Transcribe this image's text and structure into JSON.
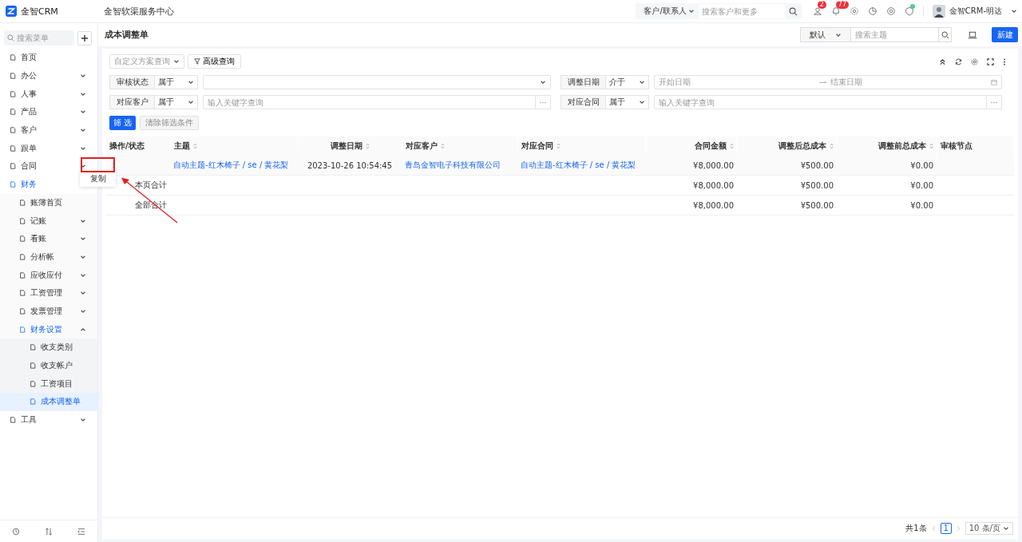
{
  "header": {
    "logo_text": "金智CRM",
    "title": "金智软渠服务中心",
    "search_scope": "客户/联系人",
    "search_placeholder": "搜索客户和更多",
    "contacts_badge": "2",
    "notice_badge": "77",
    "user_name": "金智CRM-明达"
  },
  "sidebar": {
    "search_placeholder": "搜索菜单",
    "items": [
      {
        "label": "首页",
        "selected": false
      },
      {
        "label": "办公",
        "selected": false,
        "expanded": false
      },
      {
        "label": "人事",
        "selected": false,
        "expanded": false
      },
      {
        "label": "产品",
        "selected": false,
        "expanded": false
      },
      {
        "label": "客户",
        "selected": false,
        "expanded": false
      },
      {
        "label": "跟单",
        "selected": false,
        "expanded": false
      },
      {
        "label": "合同",
        "selected": false,
        "expanded": false
      },
      {
        "label": "财务",
        "selected": false,
        "expanded": true,
        "children": [
          {
            "label": "账簿首页",
            "selected": false
          },
          {
            "label": "记账",
            "selected": false,
            "expanded": false
          },
          {
            "label": "看账",
            "selected": false,
            "expanded": false
          },
          {
            "label": "分析帐",
            "selected": false,
            "expanded": false
          },
          {
            "label": "应收应付",
            "selected": false,
            "expanded": false
          },
          {
            "label": "工资管理",
            "selected": false,
            "expanded": false
          },
          {
            "label": "发票管理",
            "selected": false,
            "expanded": false
          },
          {
            "label": "财务设置",
            "selected": false,
            "expanded": true,
            "children": [
              {
                "label": "收支类别",
                "selected": false
              },
              {
                "label": "收支帐户",
                "selected": false
              },
              {
                "label": "工资项目",
                "selected": false
              },
              {
                "label": "成本调整单",
                "selected": true
              }
            ]
          }
        ]
      },
      {
        "label": "工具",
        "selected": false,
        "expanded": false
      }
    ]
  },
  "page": {
    "title": "成本调整单",
    "view": "默认",
    "search_placeholder": "搜索主题",
    "new_button": "新建"
  },
  "filters": {
    "scheme_placeholder": "自定义方案查询",
    "advanced_button": "高级查询",
    "rows": [
      {
        "label": "审核状态",
        "operator": "属于",
        "kind": "select"
      },
      {
        "label": "调整日期",
        "operator": "介于",
        "kind": "date",
        "start_placeholder": "开始日期",
        "end_placeholder": "结束日期"
      },
      {
        "label": "对应客户",
        "operator": "属于",
        "kind": "lookup",
        "placeholder": "输入关键字查询"
      },
      {
        "label": "对应合同",
        "operator": "属于",
        "kind": "lookup",
        "placeholder": "输入关键字查询"
      }
    ],
    "filter_button": "筛 选",
    "clear_button": {
      "label": "清除筛选条件",
      "disabled": true
    }
  },
  "table": {
    "columns": [
      {
        "label": "操作/状态",
        "kind": "actions",
        "sortable": false
      },
      {
        "label": "主题",
        "kind": "link",
        "sortable": true
      },
      {
        "label": "调整日期",
        "kind": "date",
        "sortable": true
      },
      {
        "label": "对应客户",
        "kind": "link",
        "sortable": true
      },
      {
        "label": "对应合同",
        "kind": "link",
        "sortable": true
      },
      {
        "label": "合同金额",
        "kind": "money",
        "sortable": true
      },
      {
        "label": "调整后总成本",
        "kind": "money",
        "sortable": true
      },
      {
        "label": "调整前总成本",
        "kind": "money",
        "sortable": true
      },
      {
        "label": "审核节点",
        "kind": "text",
        "sortable": false
      }
    ],
    "rows": [
      {
        "kind": "data",
        "cells": [
          null,
          "自动主题-红木椅子 / se / 黄花梨",
          "2023-10-26 10:54:45",
          "青岛金智电子科技有限公司",
          "自动主题-红木椅子 / se / 黄花梨",
          "¥8,000.00",
          "¥500.00",
          "¥0.00",
          null
        ]
      },
      {
        "kind": "summary",
        "cells": [
          "本页合计",
          null,
          null,
          null,
          null,
          "¥8,000.00",
          "¥500.00",
          "¥0.00",
          null
        ]
      },
      {
        "kind": "summary",
        "cells": [
          "全部合计",
          null,
          null,
          null,
          null,
          "¥8,000.00",
          "¥500.00",
          "¥0.00",
          null
        ]
      }
    ]
  },
  "context_menu": {
    "items": [
      "复制"
    ]
  },
  "pagination": {
    "total": "共1条",
    "pages": [
      {
        "label": "1",
        "selected": true
      }
    ],
    "page_size": "10 条/页"
  }
}
